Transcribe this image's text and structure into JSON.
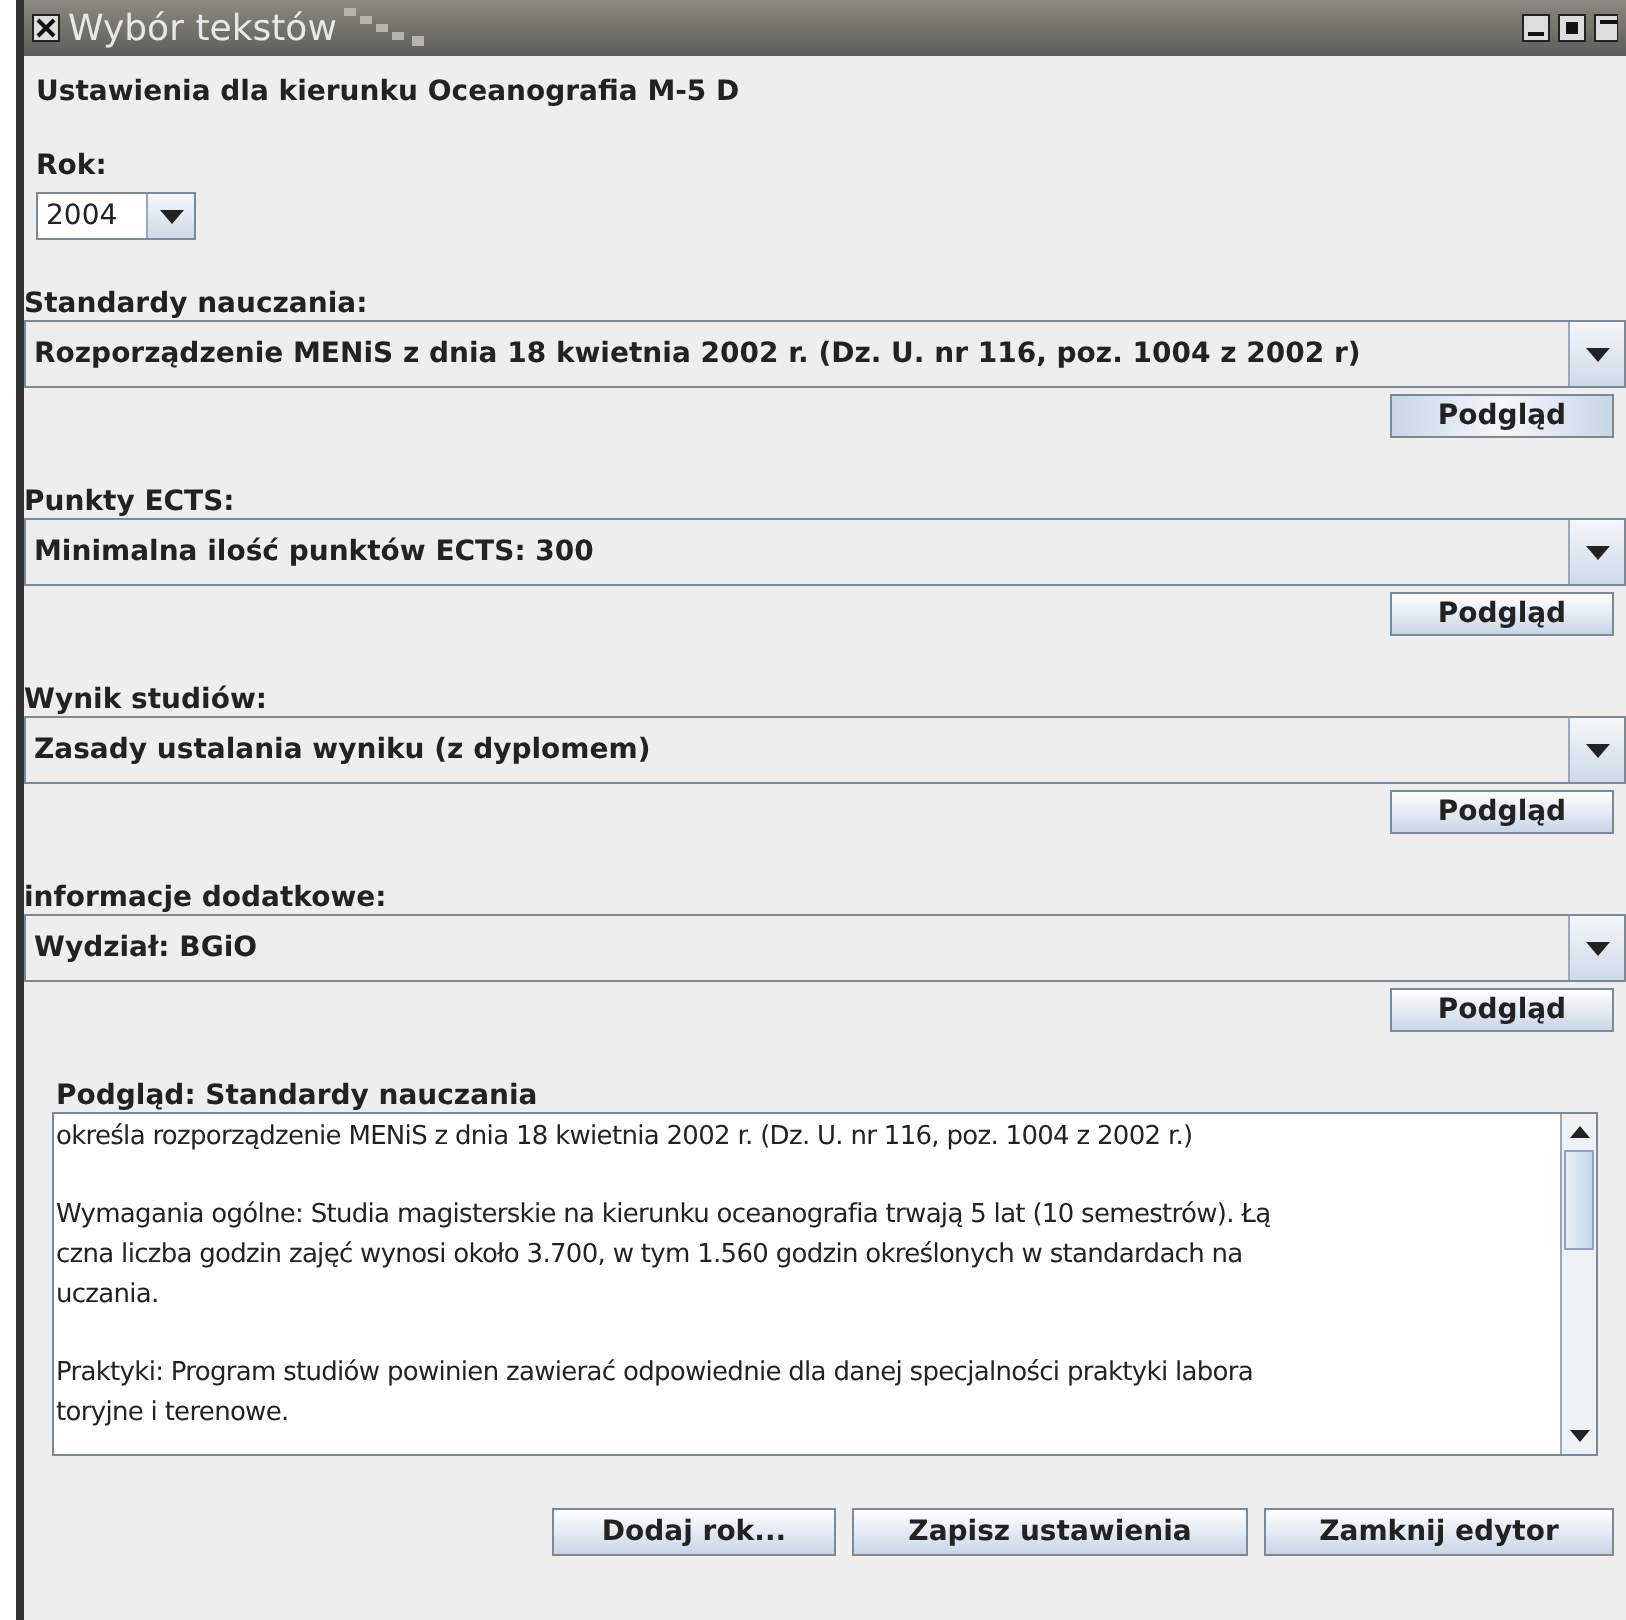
{
  "window": {
    "title": "Wybór tekstów"
  },
  "heading": "Ustawienia dla kierunku Oceanografia M-5 D",
  "year": {
    "label": "Rok:",
    "value": "2004"
  },
  "sections": [
    {
      "label": "Standardy nauczania:",
      "value": "Rozporządzenie MENiS z dnia 18 kwietnia 2002 r. (Dz. U. nr 116, poz. 1004 z 2002 r)",
      "button": "Podgląd",
      "focused": true
    },
    {
      "label": "Punkty ECTS:",
      "value": "Minimalna ilość punktów ECTS: 300",
      "button": "Podgląd",
      "focused": false
    },
    {
      "label": "Wynik studiów:",
      "value": "Zasady ustalania wyniku (z dyplomem)",
      "button": "Podgląd",
      "focused": false
    },
    {
      "label": "informacje dodatkowe:",
      "value": "Wydział: BGiO",
      "button": "Podgląd",
      "focused": false
    }
  ],
  "preview": {
    "label": "Podgląd: Standardy nauczania",
    "paragraphs": [
      [
        "określa rozporządzenie MENiS z dnia 18 kwietnia 2002 r. (Dz. U. nr 116, poz. 1004 z 2002 r.)"
      ],
      [
        "Wymagania ogólne: Studia magisterskie na kierunku oceanografia trwają 5 lat (10 semestrów). Łą",
        "czna liczba godzin zajęć wynosi około 3.700, w tym 1.560 godzin określonych w standardach na",
        "uczania."
      ],
      [
        "Praktyki: Program studiów powinien zawierać odpowiednie dla danej specjalności praktyki labora",
        "toryjne i terenowe."
      ]
    ]
  },
  "buttons": [
    "Dodaj rok...",
    "Zapisz ustawienia",
    "Zamknij edytor"
  ]
}
